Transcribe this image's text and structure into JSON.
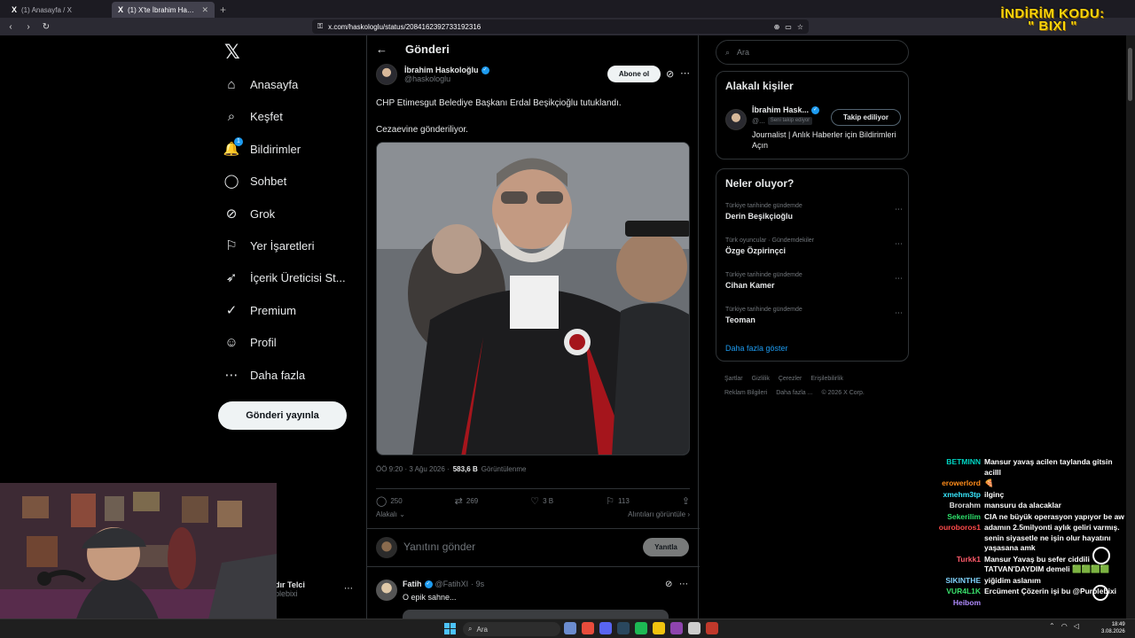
{
  "browser": {
    "tabs": [
      {
        "title": "(1) Anasayfa / X",
        "active": false
      },
      {
        "title": "(1) X'te İbrahim Haskoloğlu: \"CHP",
        "active": true
      }
    ],
    "url": "x.com/haskologlu/status/2084162392733192316"
  },
  "promo": {
    "line1": "İNDİRİM KODU:",
    "line2": "\" BIXI \""
  },
  "nav": {
    "items": [
      {
        "label": "Anasayfa",
        "icon": "home-icon",
        "glyph": "⌂"
      },
      {
        "label": "Keşfet",
        "icon": "search-icon",
        "glyph": "⌕"
      },
      {
        "label": "Bildirimler",
        "icon": "bell-icon",
        "glyph": "🔔",
        "badge": "1"
      },
      {
        "label": "Sohbet",
        "icon": "chat-icon",
        "glyph": "◯"
      },
      {
        "label": "Grok",
        "icon": "grok-icon",
        "glyph": "⊘"
      },
      {
        "label": "Yer İşaretleri",
        "icon": "bookmark-icon",
        "glyph": "⚐"
      },
      {
        "label": "İçerik Üreticisi St...",
        "icon": "rocket-icon",
        "glyph": "➶"
      },
      {
        "label": "Premium",
        "icon": "premium-icon",
        "glyph": "✓"
      },
      {
        "label": "Profil",
        "icon": "profile-icon",
        "glyph": "☺"
      },
      {
        "label": "Daha fazla",
        "icon": "more-icon",
        "glyph": "⋯"
      }
    ],
    "post_button": "Gönderi yayınla",
    "account": {
      "name": "dır Telci",
      "handle": "plebixi"
    }
  },
  "post": {
    "header": "Gönderi",
    "author": {
      "name": "İbrahim Haskoloğlu",
      "handle": "@haskologlu"
    },
    "follow_label": "Abone ol",
    "text1": "CHP Etimesgut Belediye Başkanı Erdal Beşikçioğlu tutuklandı.",
    "text2": "Cezaevine gönderiliyor.",
    "time": "ÖÖ 9:20 · 3 Ağu 2026 ·",
    "views": "583,6 B",
    "views_label": "Görüntülenme",
    "stats": {
      "replies": "250",
      "reposts": "269",
      "likes": "3 B",
      "bookmarks": "113"
    },
    "related_label": "Alakalı",
    "quotes_label": "Alıntıları görüntüle",
    "reply_placeholder": "Yanıtını gönder",
    "reply_button": "Yanıtla"
  },
  "reply": {
    "name": "Fatih",
    "handle": "@FatihXI",
    "time": "· 9s",
    "text": "O epik sahne..."
  },
  "sidebar": {
    "search_placeholder": "Ara",
    "related_title": "Alakalı kişiler",
    "related_person": {
      "name": "İbrahim Hask...",
      "handle": "@...",
      "follows_you": "Seni takip ediyor",
      "bio": "Journalist | Anlık Haberler için Bildirimleri Açın",
      "button": "Takip ediliyor"
    },
    "trends_title": "Neler oluyor?",
    "trends": [
      {
        "context": "Türkiye tarihinde gündemde",
        "title": "Derin Beşikçioğlu"
      },
      {
        "context": "Türk oyuncular · Gündemdekiler",
        "title": "Özge Özpirinçci"
      },
      {
        "context": "Türkiye tarihinde gündemde",
        "title": "Cihan Kamer"
      },
      {
        "context": "Türkiye tarihinde gündemde",
        "title": "Teoman"
      }
    ],
    "show_more": "Daha fazla göster",
    "footer_row1": [
      "Şartlar",
      "Gizlilik",
      "Çerezler",
      "Erişilebilirlik"
    ],
    "footer_row2": [
      "Reklam Bilgileri",
      "Daha fazla ...",
      "© 2026 X Corp."
    ]
  },
  "chat": [
    {
      "user": "BETMINN",
      "color": "#00d5c3",
      "msg": "Mansur yavaş acilen taylanda gitsin acilll"
    },
    {
      "user": "erowerlord",
      "color": "#ff8c1a",
      "msg": "🍕"
    },
    {
      "user": "xmehm3tp",
      "color": "#38e8ff",
      "msg": "ilginç"
    },
    {
      "user": "Brorahm",
      "color": "#e0e0e0",
      "msg": "mansuru da alacaklar"
    },
    {
      "user": "Sekerilim",
      "color": "#2ee06b",
      "msg": "CIA ne büyük operasyon yapıyor be aw"
    },
    {
      "user": "ouroboros1",
      "color": "#ff4b4b",
      "msg": "adamın 2.5milyonti aylık geliri varmış. senin siyasetle ne işin olur hayatını yaşasana amk"
    },
    {
      "user": "Turkk1",
      "color": "#ff5a6a",
      "msg": "Mansur Yavaş bu sefer ciddili TATVAN'DAYDIM demeli 🟩🟩🟩🟩"
    },
    {
      "user": "SIKINTHE",
      "color": "#7fd3ff",
      "msg": "yiğidim aslanım"
    },
    {
      "user": "VUR4L1K",
      "color": "#39e06c",
      "msg": "Ercüment Çözerin işi bu @Purplebixi"
    },
    {
      "user": "Heibom",
      "color": "#b18cff",
      "msg": ""
    }
  ],
  "taskbar": {
    "search": "Ara",
    "time": "18:49",
    "date": "3.08.2026"
  },
  "colors": {
    "accent": "#1d9bf0",
    "bg": "#000000",
    "border": "#2f3336",
    "muted": "#71767b"
  }
}
